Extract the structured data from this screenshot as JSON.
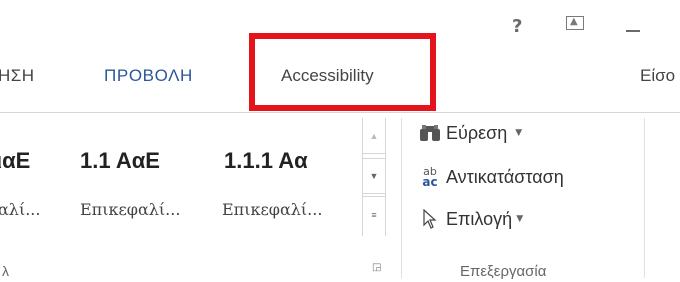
{
  "window": {
    "help_label": "?"
  },
  "tabs": [
    {
      "label": "ΗΣΗ"
    },
    {
      "label": "ΠΡΟΒΟΛΗ"
    },
    {
      "label": "Accessibility"
    },
    {
      "label": "Είσο"
    }
  ],
  "styles": {
    "samples": [
      {
        "sample": "ιαΕ",
        "label": "αλί..."
      },
      {
        "sample": "1.1  ΑαΕ",
        "label": "Επικεφαλί..."
      },
      {
        "sample": "1.1.1  Αα",
        "label": "Επικεφαλί..."
      }
    ],
    "group_label": "λ"
  },
  "editing": {
    "find_label": "Εύρεση",
    "replace_label": "Αντικατάσταση",
    "replace_icon_text": "ab",
    "select_label": "Επιλογή",
    "group_label": "Επεξεργασία"
  },
  "colors": {
    "accent_tab": "#2b579a",
    "highlight": "#e3141b"
  },
  "icons": {
    "find": "binoculars-icon",
    "replace": "replace-icon",
    "select": "pointer-icon"
  }
}
